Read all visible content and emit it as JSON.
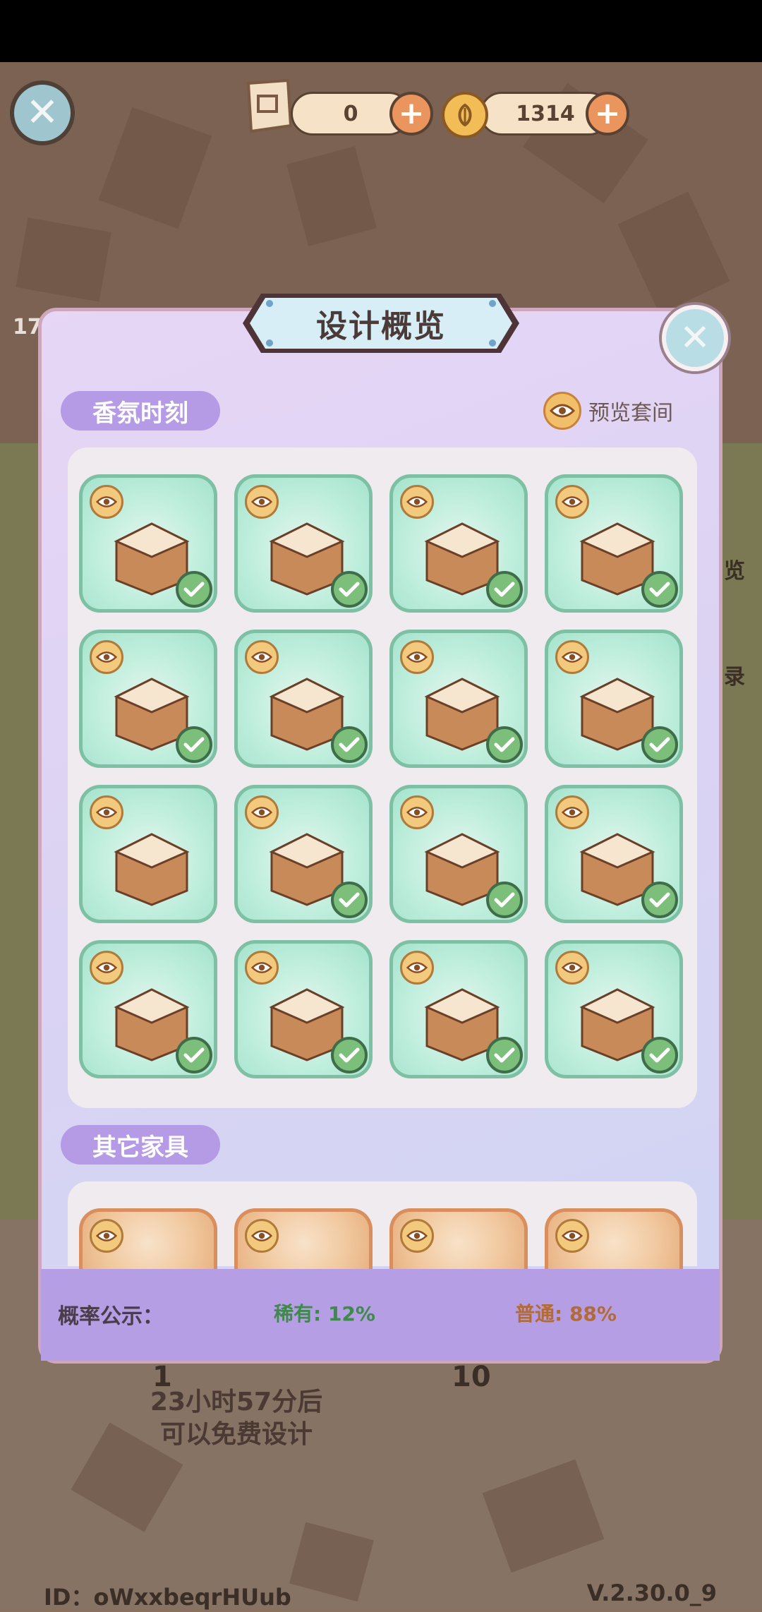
{
  "currencies": {
    "blueprint": "0",
    "coins": "1314"
  },
  "dialog": {
    "title": "设计概览",
    "section1": "香氛时刻",
    "preview_set": "预览套间",
    "section2": "其它家具"
  },
  "probability": {
    "label": "概率公示：",
    "rare": "稀有: 12%",
    "normal": "普通: 88%"
  },
  "free_design": {
    "line1": "23小时57分后",
    "line2": "可以免费设计"
  },
  "background": {
    "peek_left": "17",
    "peek_right_1": "览",
    "peek_right_2": "录",
    "peek_bottom_1": "1",
    "peek_bottom_10": "10"
  },
  "footer": {
    "id": "ID：oWxxbeqrHUub",
    "version": "V.2.30.0_9"
  },
  "items_set": [
    {
      "name": "floor-tiles",
      "owned": true
    },
    {
      "name": "cabinet",
      "owned": true
    },
    {
      "name": "sink-vanity",
      "owned": true
    },
    {
      "name": "bathtub",
      "owned": true
    },
    {
      "name": "low-cabinet",
      "owned": true
    },
    {
      "name": "shelf-cabinet",
      "owned": true
    },
    {
      "name": "shower-screen",
      "owned": true
    },
    {
      "name": "toilet",
      "owned": true
    },
    {
      "name": "tall-shelf",
      "owned": false
    },
    {
      "name": "wall-panel",
      "owned": true
    },
    {
      "name": "washing-machine-cabinet",
      "owned": true
    },
    {
      "name": "mirror",
      "owned": true
    },
    {
      "name": "glass-cabinet",
      "owned": true
    },
    {
      "name": "window-blinds",
      "owned": true
    },
    {
      "name": "storage-shelf",
      "owned": true
    },
    {
      "name": "shower-arch",
      "owned": true
    }
  ],
  "colors": {
    "tile_border": "#7ec0a4",
    "section_pill": "#b59ae6",
    "check": "#7bbf7b",
    "accent_orange": "#e9955d"
  }
}
